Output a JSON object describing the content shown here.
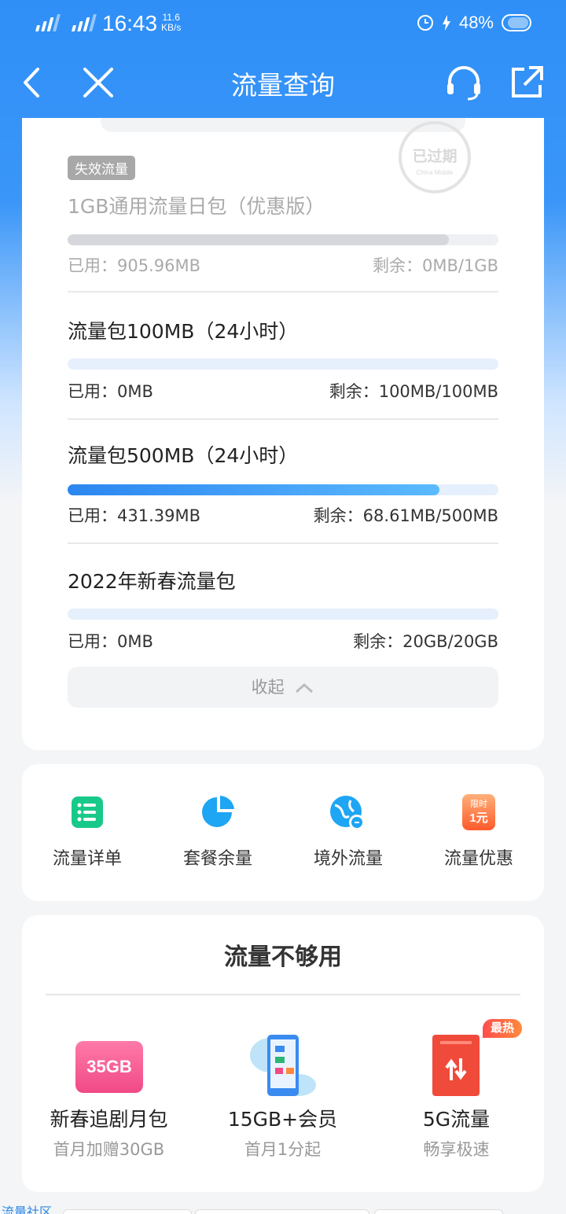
{
  "status": {
    "time": "16:43",
    "speed_value": "11.6",
    "speed_unit": "KB/s",
    "battery": "48%"
  },
  "nav": {
    "title": "流量查询"
  },
  "expired_pkg": {
    "tag": "失效流量",
    "title": "1GB通用流量日包（优惠版）",
    "used": "已用：905.96MB",
    "remain": "剩余：0MB/1GB",
    "fill_percent": 88.5,
    "stamp": "已过期",
    "stamp_sub": "China Mobile"
  },
  "packages": [
    {
      "title": "流量包100MB（24小时）",
      "used": "已用：0MB",
      "remain": "剩余：100MB/100MB",
      "fill_percent": 0
    },
    {
      "title": "流量包500MB（24小时）",
      "used": "已用：431.39MB",
      "remain": "剩余：68.61MB/500MB",
      "fill_percent": 86.3
    },
    {
      "title": "2022年新春流量包",
      "used": "已用：0MB",
      "remain": "剩余：20GB/20GB",
      "fill_percent": 0
    }
  ],
  "collapse_label": "收起",
  "quick_actions": [
    {
      "label": "流量详单",
      "icon": "list-icon"
    },
    {
      "label": "套餐余量",
      "icon": "pie-chart-icon"
    },
    {
      "label": "境外流量",
      "icon": "globe-icon"
    },
    {
      "label": "流量优惠",
      "icon": "coupon-icon",
      "badge_top": "限时",
      "badge_bottom": "1元"
    }
  ],
  "promo": {
    "title": "流量不够用",
    "offers": [
      {
        "name": "新春追剧月包",
        "sub": "首月加赠30GB",
        "badge": "35GB"
      },
      {
        "name": "15GB+会员",
        "sub": "首月1分起"
      },
      {
        "name": "5G流量",
        "sub": "畅享极速",
        "hot": "最热"
      }
    ]
  },
  "bottom": {
    "community": "流量社区"
  },
  "colors": {
    "primary": "#2f8ff7",
    "bar_fill_start": "#2b86f0",
    "bar_fill_end": "#5cbaff",
    "expired_fill": "#d6d7dc",
    "hot": "#ff6a3d",
    "green": "#19c98a"
  }
}
